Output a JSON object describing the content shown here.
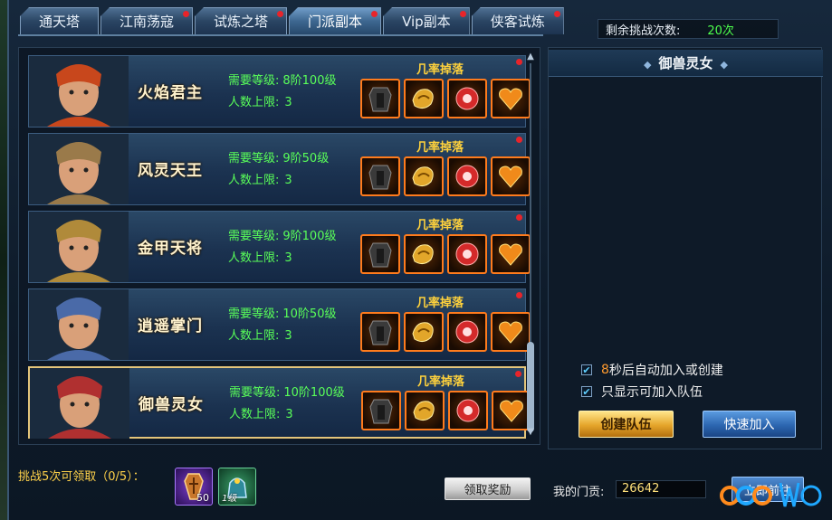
{
  "tabs": [
    {
      "label": "通天塔",
      "dot": false,
      "active": false
    },
    {
      "label": "江南荡寇",
      "dot": true,
      "active": false
    },
    {
      "label": "试炼之塔",
      "dot": true,
      "active": false
    },
    {
      "label": "门派副本",
      "dot": true,
      "active": true
    },
    {
      "label": "Vip副本",
      "dot": true,
      "active": false
    },
    {
      "label": "侠客试炼",
      "dot": true,
      "active": false
    }
  ],
  "remaining": {
    "label": "剩余挑战次数:",
    "value": "20次"
  },
  "dungeons": [
    {
      "name": "火焰君主",
      "req_label": "需要等级:",
      "req_value": "8阶100级",
      "cap_label": "人数上限:",
      "cap_value": "3",
      "drop_title": "几率掉落",
      "selected": false,
      "portrait_color": "#c8471c"
    },
    {
      "name": "风灵天王",
      "req_label": "需要等级:",
      "req_value": "9阶50级",
      "cap_label": "人数上限:",
      "cap_value": "3",
      "drop_title": "几率掉落",
      "selected": false,
      "portrait_color": "#9a7a4a"
    },
    {
      "name": "金甲天将",
      "req_label": "需要等级:",
      "req_value": "9阶100级",
      "cap_label": "人数上限:",
      "cap_value": "3",
      "drop_title": "几率掉落",
      "selected": false,
      "portrait_color": "#b08a3a"
    },
    {
      "name": "逍遥掌门",
      "req_label": "需要等级:",
      "req_value": "10阶50级",
      "cap_label": "人数上限:",
      "cap_value": "3",
      "drop_title": "几率掉落",
      "selected": false,
      "portrait_color": "#4a6aa8"
    },
    {
      "name": "御兽灵女",
      "req_label": "需要等级:",
      "req_value": "10阶100级",
      "cap_label": "人数上限:",
      "cap_value": "3",
      "drop_title": "几率掉落",
      "selected": true,
      "portrait_color": "#b03030"
    }
  ],
  "drop_items": [
    "dark-armor-icon",
    "golden-scroll-icon",
    "red-orb-icon",
    "fire-heart-icon"
  ],
  "panel": {
    "title": "御兽灵女",
    "auto_join": {
      "num": "8",
      "text": "秒后自动加入或创建",
      "checked": true
    },
    "show_joinable": {
      "text": "只显示可加入队伍",
      "checked": true
    },
    "create_label": "创建队伍",
    "quick_label": "快速加入"
  },
  "bottom": {
    "challenge_text": "挑战5次可领取（0/5）：",
    "reward1_count": "50",
    "reward2_level": "1级",
    "claim_label": "领取奖励",
    "contrib_label": "我的门贡:",
    "contrib_value": "26642",
    "goto_label": "立即前往"
  },
  "colors": {
    "accent_green": "#59ff59",
    "accent_gold": "#ffd23c",
    "dot_red": "#e8242a"
  }
}
